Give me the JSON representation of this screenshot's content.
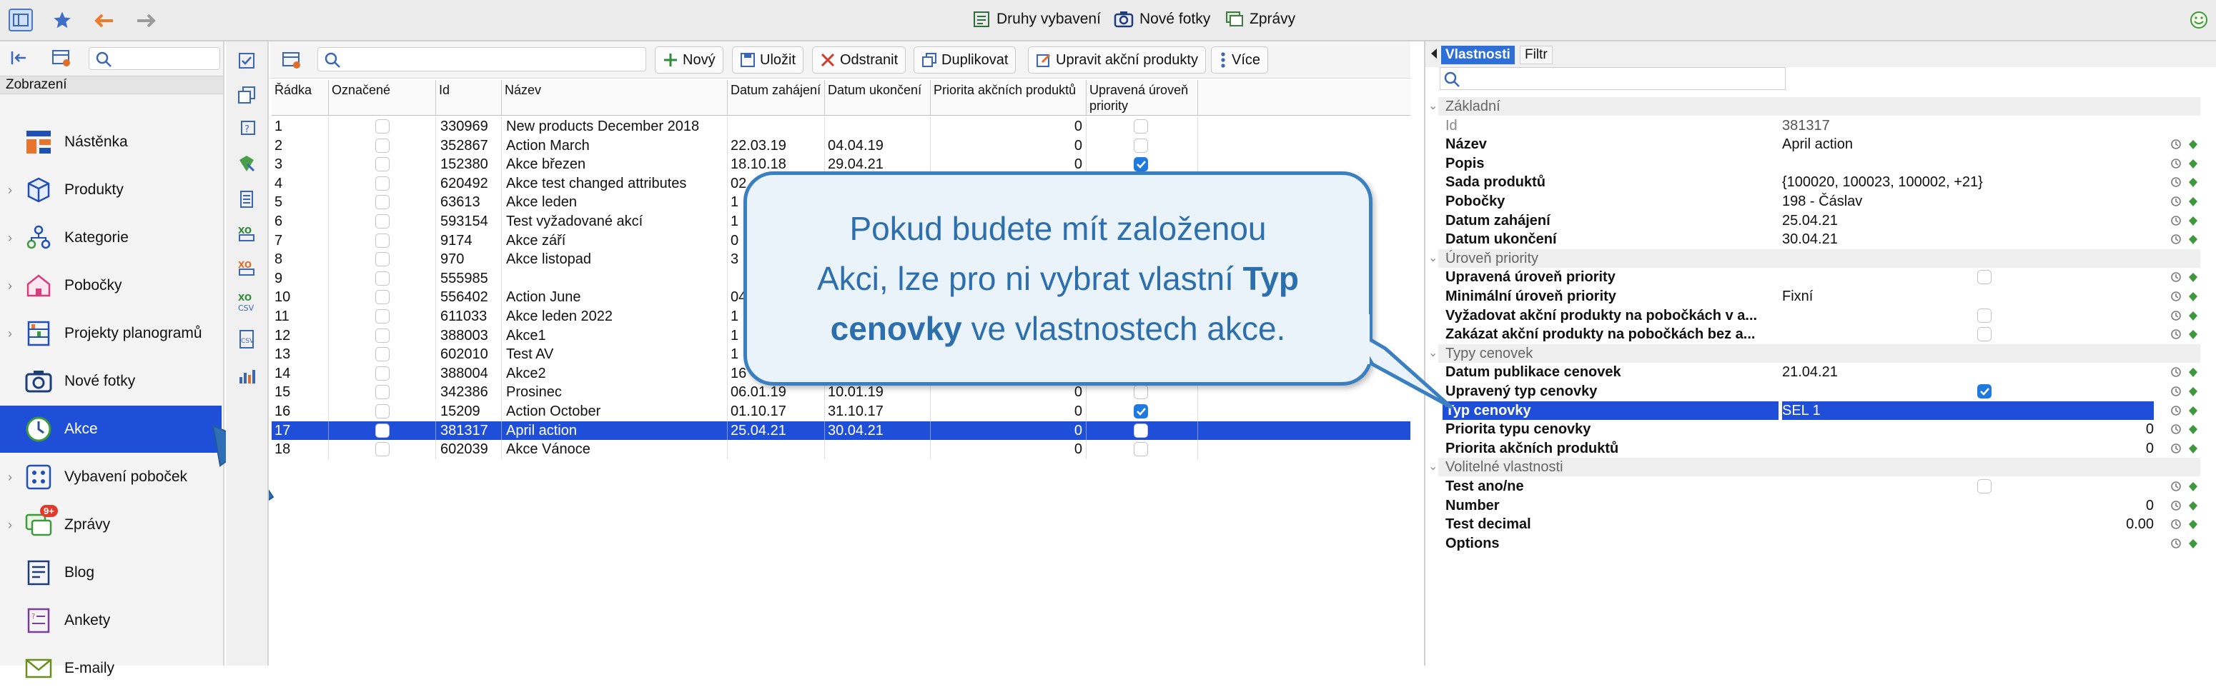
{
  "topbar": {
    "buttons": [
      {
        "label": "Druhy vybavení",
        "icon": "equipment-icon"
      },
      {
        "label": "Nové fotky",
        "icon": "camera-icon"
      },
      {
        "label": "Zprávy",
        "icon": "messages-icon"
      }
    ]
  },
  "left": {
    "section_label": "Zobrazení",
    "items": [
      {
        "label": "Nástěnka",
        "icon": "dashboard-icon",
        "chevron": false
      },
      {
        "label": "Produkty",
        "icon": "products-icon",
        "chevron": true
      },
      {
        "label": "Kategorie",
        "icon": "categories-icon",
        "chevron": true
      },
      {
        "label": "Pobočky",
        "icon": "branches-icon",
        "chevron": true
      },
      {
        "label": "Projekty planogramů",
        "icon": "planogram-icon",
        "chevron": true
      },
      {
        "label": "Nové fotky",
        "icon": "camera-icon",
        "chevron": false
      },
      {
        "label": "Akce",
        "icon": "action-clock-icon",
        "chevron": false,
        "selected": true
      },
      {
        "label": "Vybavení poboček",
        "icon": "equipment-grid-icon",
        "chevron": true
      },
      {
        "label": "Zprávy",
        "icon": "messages-icon",
        "chevron": true,
        "badge": "9+"
      },
      {
        "label": "Blog",
        "icon": "blog-icon",
        "chevron": false
      },
      {
        "label": "Ankety",
        "icon": "survey-icon",
        "chevron": false
      },
      {
        "label": "E-maily",
        "icon": "mail-icon",
        "chevron": false
      }
    ]
  },
  "toolbar": {
    "buttons": [
      {
        "label": "Nový",
        "icon": "plus-icon"
      },
      {
        "label": "Uložit",
        "icon": "save-icon"
      },
      {
        "label": "Odstranit",
        "icon": "delete-icon"
      },
      {
        "label": "Duplikovat",
        "icon": "duplicate-icon"
      },
      {
        "label": "Upravit akční produkty",
        "icon": "edit-icon"
      },
      {
        "label": "Více",
        "icon": "more-icon"
      }
    ]
  },
  "table": {
    "headers": [
      "Řádka",
      "Označené",
      "Id",
      "Název",
      "Datum zahájení",
      "Datum ukončení",
      "Priorita akčních produktů",
      "Upravená úroveň priority"
    ],
    "rows": [
      {
        "n": "1",
        "id": "330969",
        "name": "New products December 2018",
        "start": "",
        "end": "",
        "prio": "0",
        "checked": false
      },
      {
        "n": "2",
        "id": "352867",
        "name": "Action March",
        "start": "22.03.19",
        "end": "04.04.19",
        "prio": "0",
        "checked": false
      },
      {
        "n": "3",
        "id": "152380",
        "name": "Akce březen",
        "start": "18.10.18",
        "end": "29.04.21",
        "prio": "0",
        "checked": true
      },
      {
        "n": "4",
        "id": "620492",
        "name": "Akce test changed attributes",
        "start": "02",
        "end": "",
        "prio": "",
        "checked": false
      },
      {
        "n": "5",
        "id": "63613",
        "name": "Akce leden",
        "start": "1",
        "end": "",
        "prio": "",
        "checked": false
      },
      {
        "n": "6",
        "id": "593154",
        "name": "Test vyžadované akcí",
        "start": "1",
        "end": "",
        "prio": "",
        "checked": false
      },
      {
        "n": "7",
        "id": "9174",
        "name": "Akce září",
        "start": "0",
        "end": "",
        "prio": "",
        "checked": false
      },
      {
        "n": "8",
        "id": "970",
        "name": "Akce listopad",
        "start": "3",
        "end": "",
        "prio": "",
        "checked": false
      },
      {
        "n": "9",
        "id": "555985",
        "name": "",
        "start": "",
        "end": "",
        "prio": "",
        "checked": false
      },
      {
        "n": "10",
        "id": "556402",
        "name": "Action June",
        "start": "04",
        "end": "",
        "prio": "",
        "checked": false
      },
      {
        "n": "11",
        "id": "611033",
        "name": "Akce leden 2022",
        "start": "1",
        "end": "",
        "prio": "",
        "checked": false
      },
      {
        "n": "12",
        "id": "388003",
        "name": "Akce1",
        "start": "1",
        "end": "",
        "prio": "",
        "checked": false
      },
      {
        "n": "13",
        "id": "602010",
        "name": "Test AV",
        "start": "1",
        "end": "",
        "prio": "",
        "checked": false
      },
      {
        "n": "14",
        "id": "388004",
        "name": "Akce2",
        "start": "16",
        "end": "",
        "prio": "",
        "checked": false
      },
      {
        "n": "15",
        "id": "342386",
        "name": "Prosinec",
        "start": "06.01.19",
        "end": "10.01.19",
        "prio": "0",
        "checked": false
      },
      {
        "n": "16",
        "id": "15209",
        "name": "Action October",
        "start": "01.10.17",
        "end": "31.10.17",
        "prio": "0",
        "checked": true
      },
      {
        "n": "17",
        "id": "381317",
        "name": "April action",
        "start": "25.04.21",
        "end": "30.04.21",
        "prio": "0",
        "checked": false,
        "selected": true
      },
      {
        "n": "18",
        "id": "602039",
        "name": "Akce Vánoce",
        "start": "",
        "end": "",
        "prio": "0",
        "checked": false
      }
    ]
  },
  "right": {
    "tabs": [
      "Vlastnosti",
      "Filtr"
    ],
    "rows": [
      {
        "type": "section",
        "label": "Základní"
      },
      {
        "label": "Id",
        "value": "381317",
        "muted": true
      },
      {
        "label": "Název",
        "value": "April action",
        "icons": true
      },
      {
        "label": "Popis",
        "value": "",
        "icons": true
      },
      {
        "label": "Sada produktů",
        "value": "{100020, 100023, 100002, +21}",
        "icons": true
      },
      {
        "label": "Pobočky",
        "value": "198 - Čáslav",
        "icons": true
      },
      {
        "label": "Datum zahájení",
        "value": "25.04.21",
        "icons": true
      },
      {
        "label": "Datum ukončení",
        "value": "30.04.21",
        "icons": true
      },
      {
        "type": "section",
        "label": "Úroveň priority"
      },
      {
        "label": "Upravená úroveň priority",
        "value": "",
        "checkbox": "off",
        "icons": true
      },
      {
        "label": "Minimální úroveň priority",
        "value": "Fixní",
        "icons": true
      },
      {
        "label": "Vyžadovat akční produkty na pobočkách v a...",
        "value": "",
        "checkbox": "off",
        "icons": true
      },
      {
        "label": "Zakázat akční produkty na pobočkách bez a...",
        "value": "",
        "checkbox": "off",
        "icons": true
      },
      {
        "type": "section",
        "label": "Typy cenovek"
      },
      {
        "label": "Datum publikace cenovek",
        "value": "21.04.21",
        "icons": true
      },
      {
        "label": "Upravený typ cenovky",
        "value": "",
        "checkbox": "on",
        "icons": true
      },
      {
        "label": "Typ cenovky",
        "value": "SEL 1",
        "selected": true,
        "icons": true
      },
      {
        "label": "Priorita typu cenovky",
        "value": "0",
        "right": true,
        "icons": true
      },
      {
        "label": "Priorita akčních produktů",
        "value": "0",
        "right": true,
        "icons": true
      },
      {
        "type": "section",
        "label": "Volitelné vlastnosti"
      },
      {
        "label": "Test ano/ne",
        "value": "",
        "checkbox": "off",
        "icons": true
      },
      {
        "label": "Number",
        "value": "0",
        "right": true,
        "icons": true
      },
      {
        "label": "Test decimal",
        "value": "0.00",
        "right": true,
        "icons": true
      },
      {
        "label": "Options",
        "value": "",
        "icons": true
      }
    ]
  },
  "callout": {
    "line1": "Pokud budete mít založenou",
    "line2a": "Akci, lze pro ni vybrat vlastní ",
    "line2b": "Typ",
    "line3a": "cenovky",
    "line3b": " ve vlastnostech akce."
  },
  "colors": {
    "selection": "#1f4fd8",
    "callout_border": "#3a7fbf",
    "callout_text": "#2d6fad"
  }
}
